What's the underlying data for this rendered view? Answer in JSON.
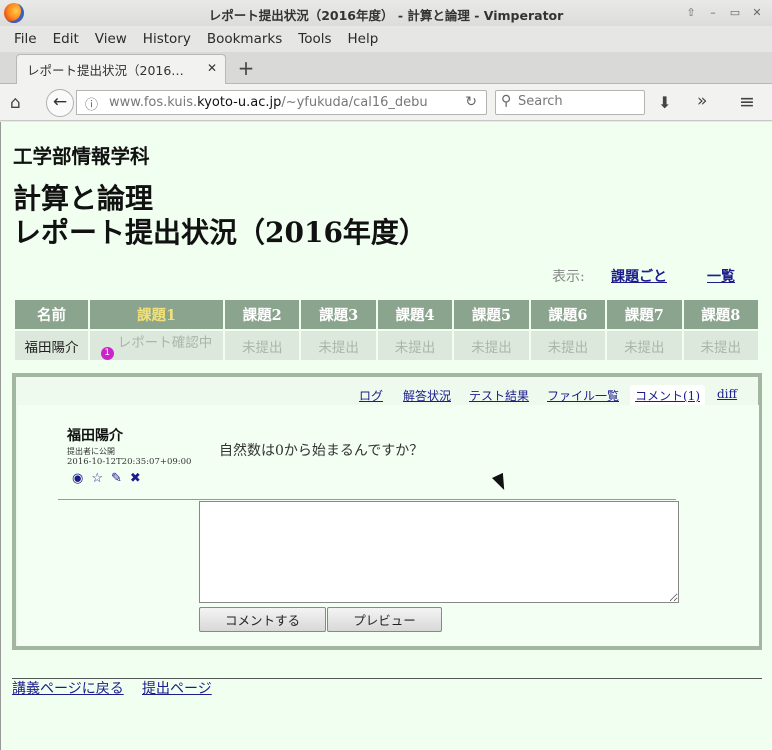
{
  "window": {
    "title": "レポート提出状況（2016年度） - 計算と論理 - Vimperator",
    "controls": [
      "⇧",
      "–",
      "▭",
      "✕"
    ]
  },
  "menu": [
    "File",
    "Edit",
    "View",
    "History",
    "Bookmarks",
    "Tools",
    "Help"
  ],
  "tab": {
    "title": "レポート提出状況（2016…",
    "close": "✕",
    "new_tab": "+"
  },
  "nav": {
    "url_prefix": "www.fos.kuis.",
    "url_domain": "kyoto-u.ac.jp",
    "url_path": "/~yfukuda/cal16_debu",
    "search_placeholder": "Search"
  },
  "page": {
    "department": "工学部情報学科",
    "title_line1": "計算と論理",
    "title_line2": "レポート提出状況（2016年度）",
    "view_label": "表示:",
    "view_by_task": "課題ごと",
    "view_list": "一覧"
  },
  "table": {
    "headers": [
      "名前",
      "課題1",
      "課題2",
      "課題3",
      "課題4",
      "課題5",
      "課題6",
      "課題7",
      "課題8"
    ],
    "active_index": 1,
    "row": {
      "name": "福田陽介",
      "badge": "1",
      "task1_status": "レポート確認中",
      "others": [
        "未提出",
        "未提出",
        "未提出",
        "未提出",
        "未提出",
        "未提出",
        "未提出"
      ]
    }
  },
  "panel": {
    "tabs": [
      "ログ",
      "解答状況",
      "テスト結果",
      "ファイル一覧",
      "コメント(1)",
      "diff"
    ],
    "selected_tab": "コメント(1)",
    "comment": {
      "author": "福田陽介",
      "visibility": "提出者に公開",
      "timestamp": "2016-10-12T20:35:07+09:00",
      "text": "自然数は0から始まるんですか？",
      "icons": [
        "eye-icon",
        "star-icon",
        "edit-icon",
        "delete-icon"
      ]
    },
    "textarea_value": "",
    "submit_label": "コメントする",
    "preview_label": "プレビュー"
  },
  "footer": {
    "back_link": "講義ページに戻る",
    "submit_page": "提出ページ"
  }
}
